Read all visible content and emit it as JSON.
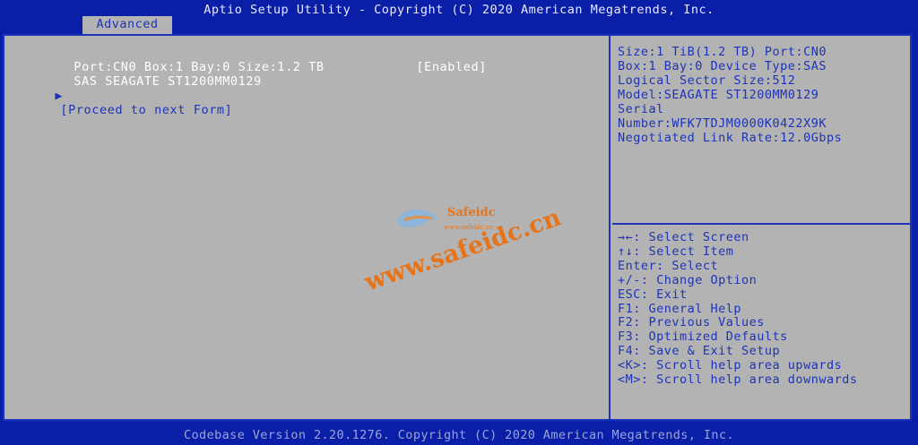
{
  "title": "Aptio Setup Utility - Copyright (C) 2020 American Megatrends, Inc.",
  "tabs": [
    {
      "label": "Advanced"
    }
  ],
  "main": {
    "device_item": {
      "label": "Port:CN0 Box:1 Bay:0 Size:1.2 TB",
      "value": "[Enabled]"
    },
    "device_subtitle": "SAS SEAGATE ST1200MM0129",
    "submenu": {
      "arrow": "▶",
      "label": "[Proceed to next Form]"
    }
  },
  "help": {
    "lines": [
      "Size:1 TiB(1.2 TB) Port:CN0",
      "Box:1 Bay:0 Device Type:SAS",
      "Logical Sector Size:512",
      "Model:SEAGATE ST1200MM0129",
      "Serial",
      "Number:WFK7TDJM0000K0422X9K",
      "Negotiated Link Rate:12.0Gbps"
    ]
  },
  "keys": [
    "→←: Select Screen",
    "↑↓: Select Item",
    "Enter: Select",
    "+/-: Change Option",
    "ESC: Exit",
    "F1: General Help",
    "F2: Previous Values",
    "F3: Optimized Defaults",
    "F4: Save & Exit Setup",
    "<K>: Scroll help area upwards",
    "<M>: Scroll help area downwards"
  ],
  "footer": "Codebase Version 2.20.1276. Copyright (C) 2020 American Megatrends, Inc.",
  "watermark": {
    "brand": "Safeidc",
    "small": "www.safeidc.cn",
    "main": "www.safeidc.cn"
  },
  "colors": {
    "background": "#0a1fa8",
    "panel": "#b3b3b3",
    "accent_text": "#1d34b8",
    "watermark": "#f06a00"
  }
}
